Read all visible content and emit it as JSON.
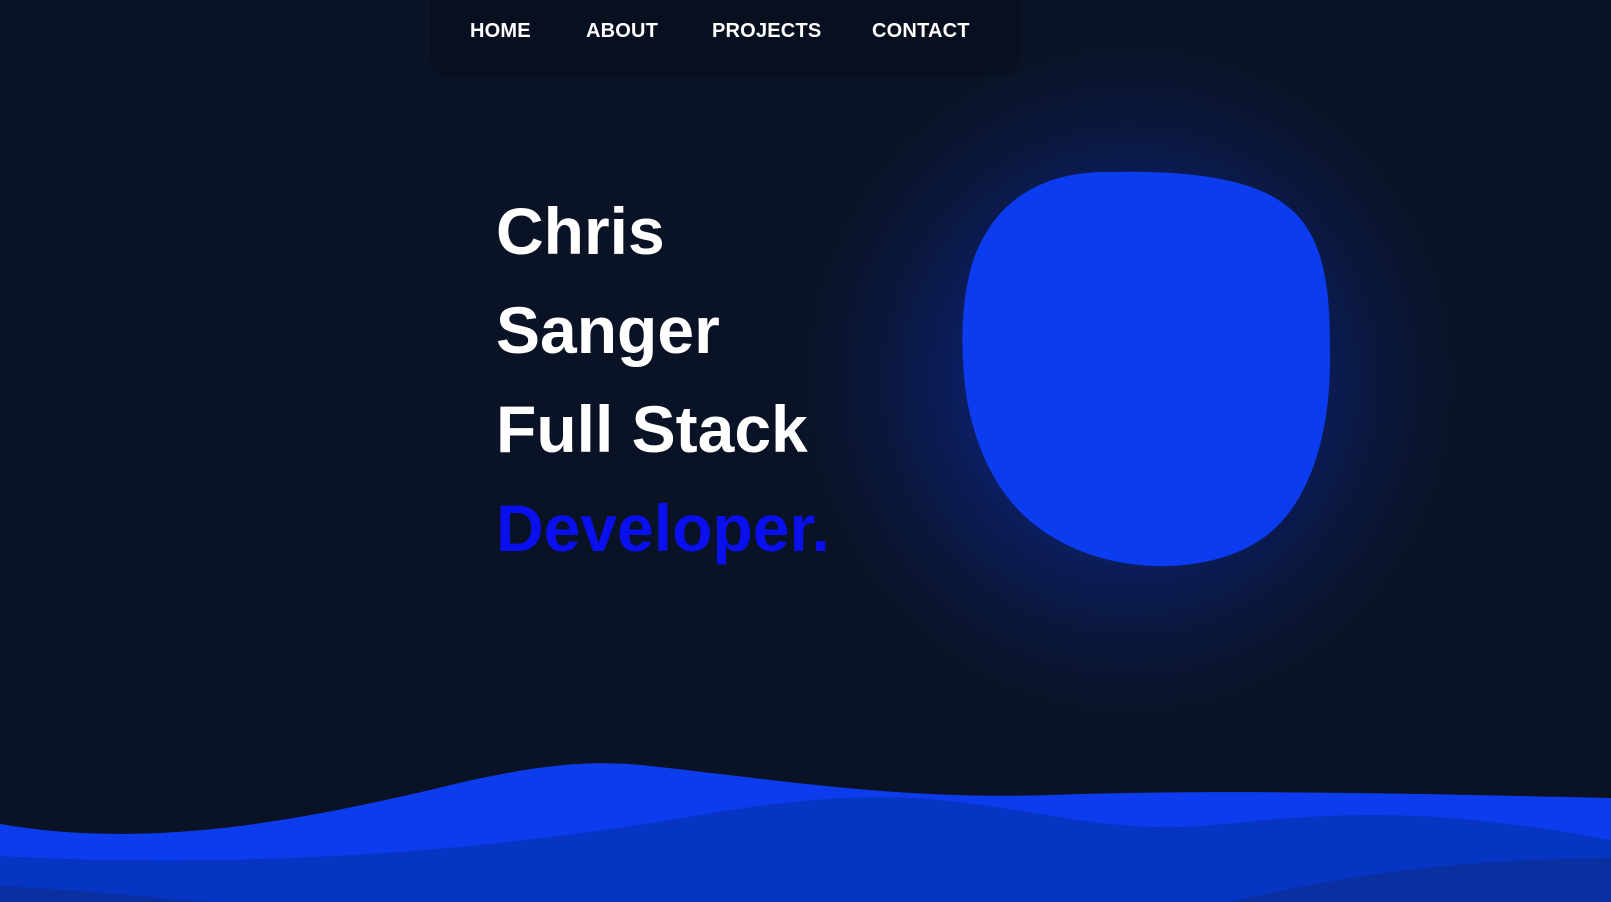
{
  "nav": {
    "home": "HOME",
    "about": "ABOUT",
    "projects": "PROJECTS",
    "contact": "CONTACT"
  },
  "hero": {
    "line1": "Chris",
    "line2": "Sanger",
    "line3": "Full Stack",
    "line4": "Developer."
  },
  "colors": {
    "background": "#0a1325",
    "navbar": "#080f1e",
    "accent_text": "#0a0ff0",
    "blob": "#0c3cf0",
    "wave_front": "#0d3cef",
    "wave_mid": "#0535c2",
    "wave_back": "#0a2fa0"
  }
}
